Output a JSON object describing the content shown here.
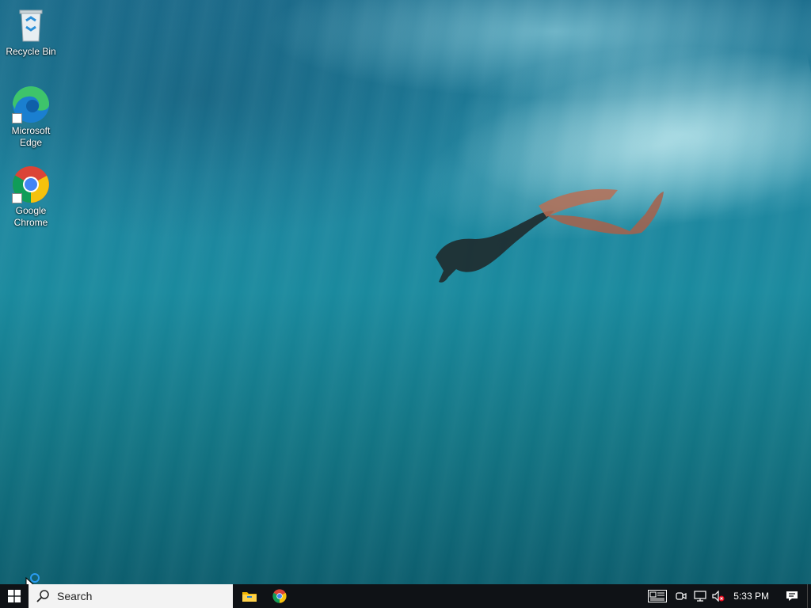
{
  "desktop": {
    "icons": [
      {
        "label": "Recycle Bin"
      },
      {
        "label": "Microsoft Edge"
      },
      {
        "label": "Google Chrome"
      }
    ]
  },
  "taskbar": {
    "search_placeholder": "Search",
    "pinned_apps": [
      "file-explorer",
      "google-chrome"
    ],
    "clock": "5:33 PM",
    "tray_icons": [
      "news-widget-icon",
      "meet-now-icon",
      "network-icon",
      "volume-muted-icon",
      "notifications-icon"
    ]
  },
  "colors": {
    "taskbar_bg": "#0f1216",
    "search_bg": "#f3f3f3",
    "water": "#1a8a9e"
  }
}
